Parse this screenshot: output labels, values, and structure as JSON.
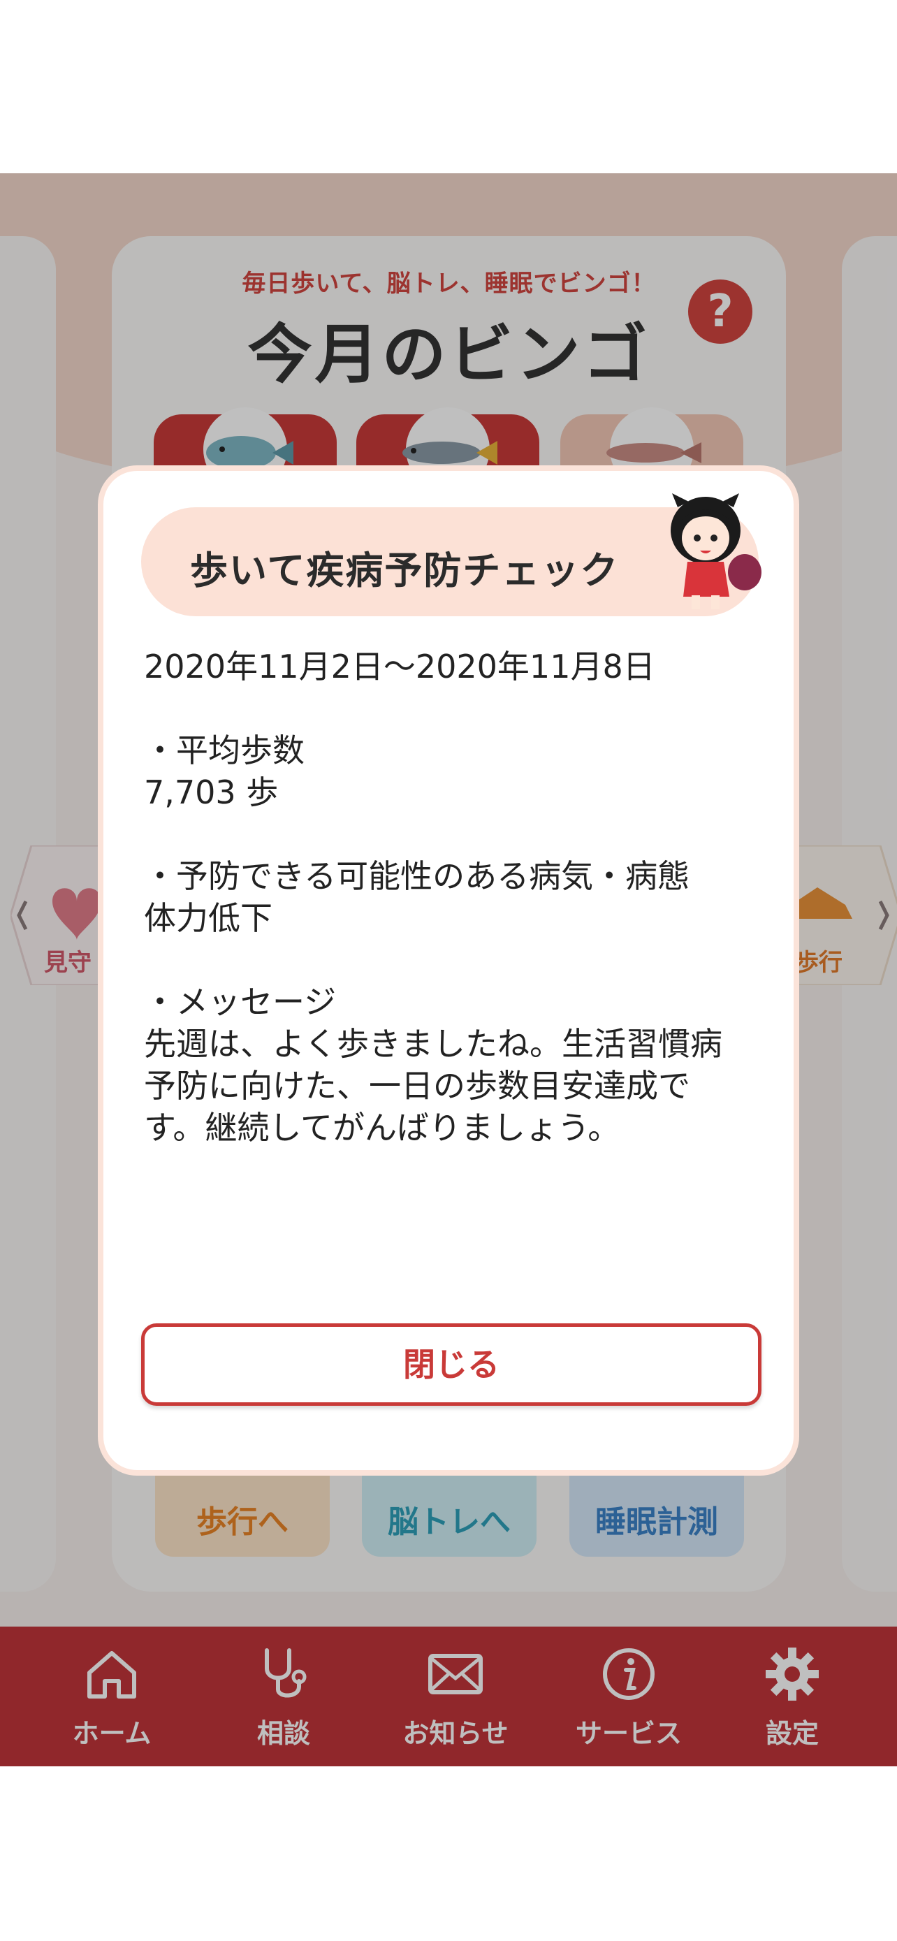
{
  "bingo": {
    "tagline": "毎日歩いて、脳トレ、睡眠でビンゴ！",
    "title": "今月のビンゴ",
    "help_icon": "?"
  },
  "side_nav": {
    "left_label": "見守",
    "right_label": "歩行"
  },
  "category_buttons": {
    "walk": "歩行へ",
    "brain": "脳トレへ",
    "sleep": "睡眠計測"
  },
  "tabbar": {
    "items": [
      {
        "label": "ホーム",
        "icon": "home-icon"
      },
      {
        "label": "相談",
        "icon": "stethoscope-icon"
      },
      {
        "label": "お知らせ",
        "icon": "mail-icon"
      },
      {
        "label": "サービス",
        "icon": "info-icon"
      },
      {
        "label": "設定",
        "icon": "gear-icon"
      }
    ]
  },
  "modal": {
    "title": "歩いて疾病予防チェック",
    "date_range": "2020年11月2日〜2020年11月8日",
    "avg_steps_heading": "・平均歩数",
    "avg_steps_value": "7,703 歩",
    "disease_heading": "・予防できる可能性のある病気・病態",
    "disease_value": "体力低下",
    "message_heading": "・メッセージ",
    "message_line1": "先週は、よく歩きましたね。生活習慣病",
    "message_line2": "予防に向けた、一日の歩数目安達成で",
    "message_line3": "す。継続してがんばりましょう。",
    "close_label": "閉じる"
  },
  "colors": {
    "accent": "#c93a38",
    "tabbar": "#c0343a",
    "modal_header": "#fce1d6"
  }
}
